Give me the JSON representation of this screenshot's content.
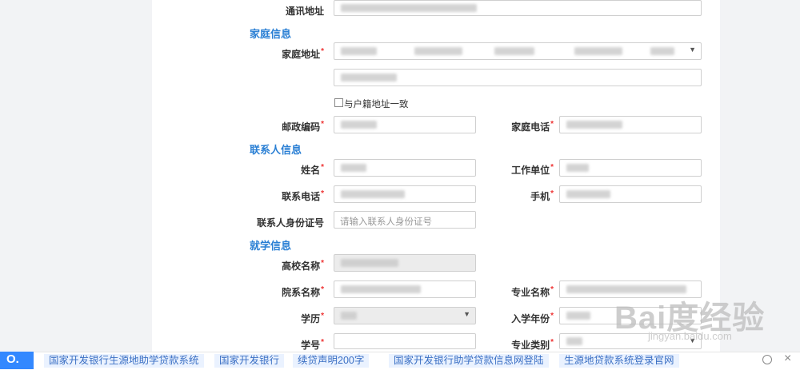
{
  "form": {
    "mailing_address_label": "通讯地址",
    "family_section": "家庭信息",
    "home_address_label": "家庭地址",
    "same_as_hukou_label": "与户籍地址一致",
    "postal_code_label": "邮政编码",
    "home_phone_label": "家庭电话",
    "contact_section": "联系人信息",
    "name_label": "姓名",
    "work_unit_label": "工作单位",
    "contact_phone_label": "联系电话",
    "mobile_label": "手机",
    "contact_id_label": "联系人身份证号",
    "contact_id_placeholder": "请输入联系人身份证号",
    "study_section": "就学信息",
    "university_label": "高校名称",
    "department_label": "院系名称",
    "major_label": "专业名称",
    "education_label": "学历",
    "enroll_year_label": "入学年份",
    "student_id_label": "学号",
    "major_category_label": "专业类别",
    "required_mark": "*"
  },
  "bottom_bar": {
    "logo": "O.",
    "tags": [
      "国家开发银行生源地助学贷款系统",
      "国家开发银行",
      "续贷声明200字",
      "国家开发银行助学贷款信息网登陆",
      "生源地贷款系统登录官网"
    ],
    "close": "×"
  },
  "watermark": {
    "brand": "Bai度经验",
    "url": "jingyan.baidu.com"
  },
  "colors": {
    "section": "#2a7fd4",
    "required": "#e33333",
    "tag_bg": "#eaf2ff",
    "logo_bg": "#3388ff"
  }
}
